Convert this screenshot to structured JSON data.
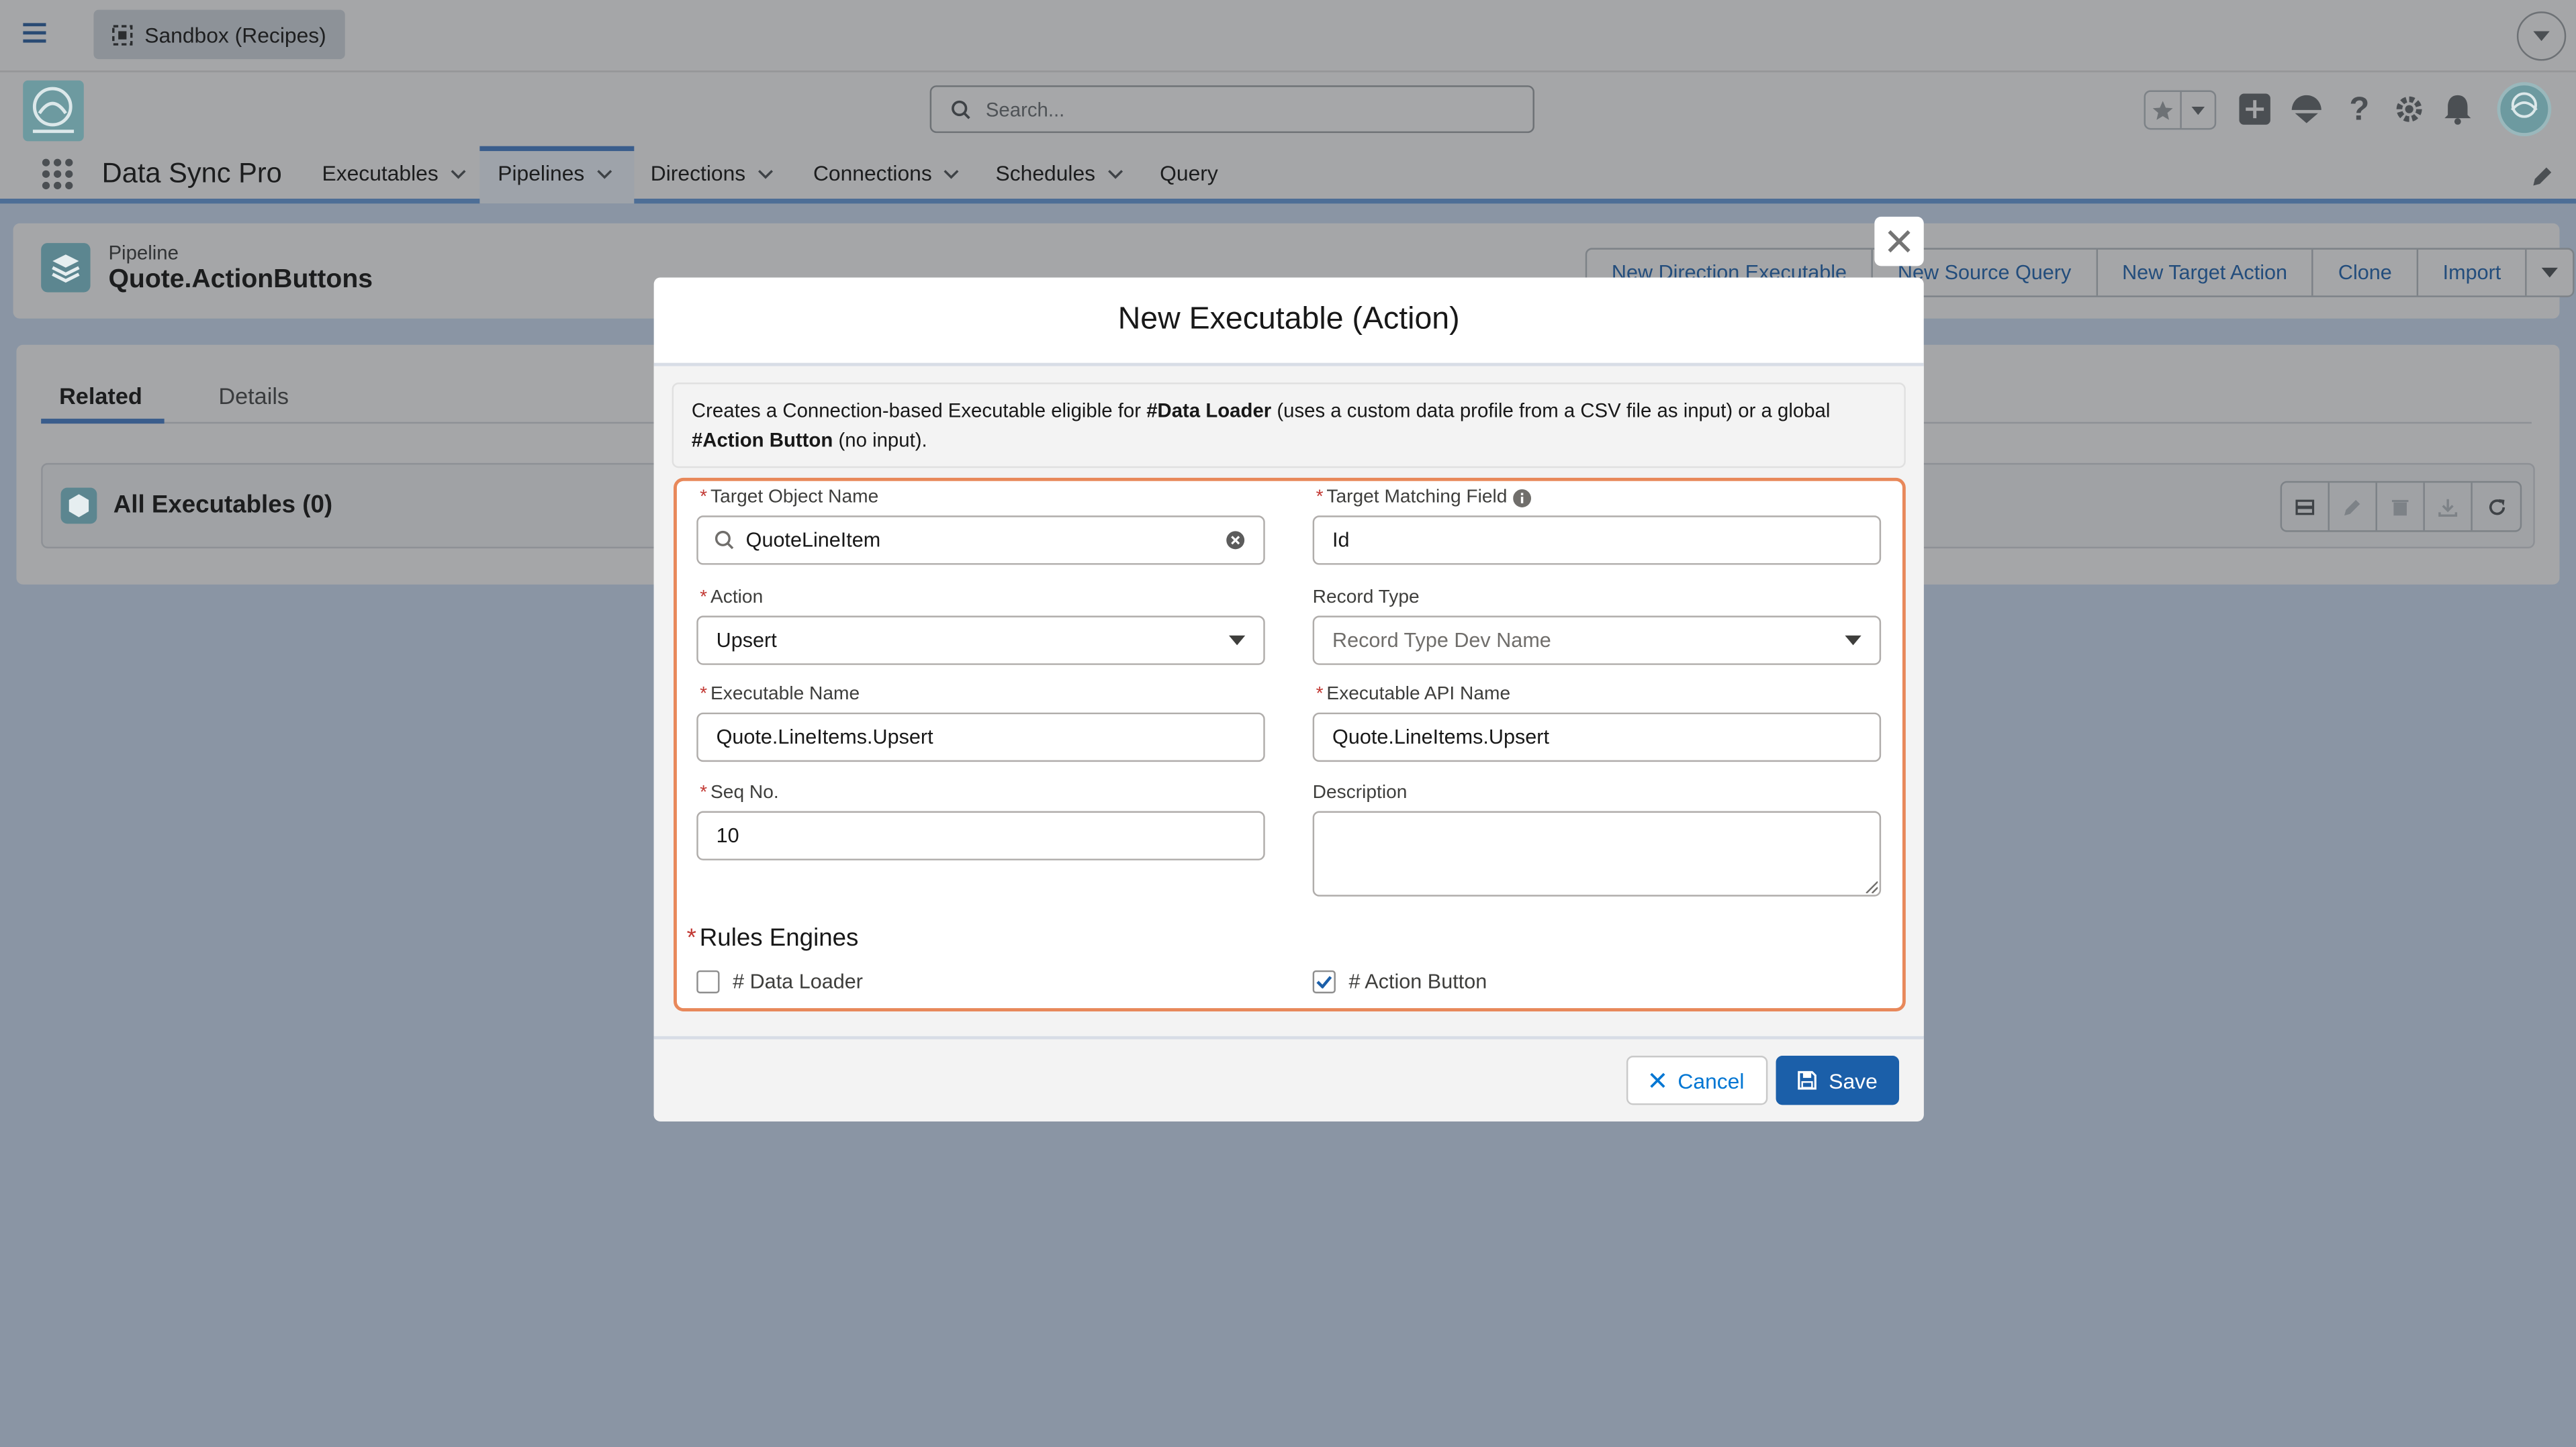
{
  "header": {
    "sandbox_label": "Sandbox (Recipes)",
    "search_placeholder": "Search...",
    "app_name": "Data Sync Pro",
    "nav": [
      {
        "label": "Executables"
      },
      {
        "label": "Pipelines"
      },
      {
        "label": "Directions"
      },
      {
        "label": "Connections"
      },
      {
        "label": "Schedules"
      },
      {
        "label": "Query"
      }
    ]
  },
  "record": {
    "type": "Pipeline",
    "name": "Quote.ActionButtons",
    "actions": [
      "New Direction Executable",
      "New Source Query",
      "New Target Action",
      "Clone",
      "Import"
    ]
  },
  "tabs": {
    "related": "Related",
    "details": "Details"
  },
  "related_list": {
    "title": "All Executables (0)"
  },
  "modal": {
    "title": "New Executable (Action)",
    "info": {
      "part1": "Creates a Connection-based Executable eligible for ",
      "bold1": "#Data Loader",
      "part2": " (uses a custom data profile from a CSV file as input) or a global ",
      "bold2": "#Action Button",
      "part3": " (no input)."
    },
    "fields": {
      "target_object_label": "Target Object Name",
      "target_object_value": "QuoteLineItem",
      "target_matching_label": "Target Matching Field",
      "target_matching_value": "Id",
      "action_label": "Action",
      "action_value": "Upsert",
      "record_type_label": "Record Type",
      "record_type_placeholder": "Record Type Dev Name",
      "exec_name_label": "Executable Name",
      "exec_name_value": "Quote.LineItems.Upsert",
      "exec_api_label": "Executable API Name",
      "exec_api_value": "Quote.LineItems.Upsert",
      "seq_label": "Seq No.",
      "seq_value": "10",
      "description_label": "Description",
      "description_value": ""
    },
    "rules": {
      "title": "Rules Engines",
      "data_loader_label": "# Data Loader",
      "data_loader_checked": false,
      "action_button_label": "# Action Button",
      "action_button_checked": true
    },
    "cancel_label": "Cancel",
    "save_label": "Save"
  },
  "colors": {
    "brand_blue": "#1b5fa9",
    "highlight_orange": "#e8885a",
    "required_red": "#c23934"
  }
}
